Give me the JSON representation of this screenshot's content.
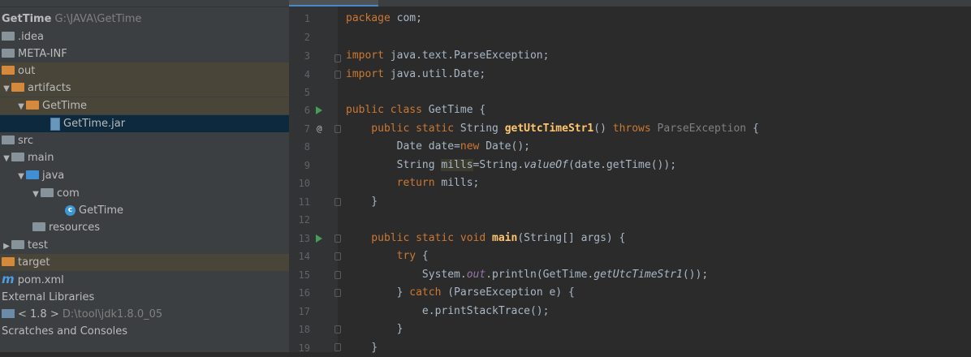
{
  "project_tree": {
    "root": {
      "name": "GetTime",
      "path": "G:\\JAVA\\GetTime"
    },
    "items": [
      {
        "label": ".idea"
      },
      {
        "label": "META-INF"
      },
      {
        "label": "out"
      },
      {
        "label": "artifacts"
      },
      {
        "label": "GetTime"
      },
      {
        "label": "GetTime.jar"
      },
      {
        "label": "src"
      },
      {
        "label": "main"
      },
      {
        "label": "java"
      },
      {
        "label": "com"
      },
      {
        "label": "GetTime"
      },
      {
        "label": "resources"
      },
      {
        "label": "test"
      },
      {
        "label": "target"
      },
      {
        "label": "pom.xml"
      },
      {
        "label": "External Libraries"
      },
      {
        "label": "< 1.8 >",
        "path": "D:\\tool\\jdk1.8.0_05"
      },
      {
        "label": "Scratches and Consoles"
      }
    ]
  },
  "editor": {
    "line_numbers": [
      "1",
      "2",
      "3",
      "4",
      "5",
      "6",
      "7",
      "8",
      "9",
      "10",
      "11",
      "12",
      "13",
      "14",
      "15",
      "16",
      "17",
      "18",
      "19"
    ],
    "code": {
      "l1_kw": "package",
      "l1_rest": " com;",
      "l3_kw": "import",
      "l3_rest": " java.text.ParseException;",
      "l4_kw": "import",
      "l4_rest": " java.util.Date;",
      "l6_kw": "public class",
      "l6_rest": " GetTime {",
      "l7_kw1": "    public static",
      "l7_t1": " String ",
      "l7_fn": "getUtcTimeStr1",
      "l7_t2": "() ",
      "l7_kw2": "throws",
      "l7_ex": " ParseException",
      "l7_t3": " {",
      "l8_t1": "        Date date=",
      "l8_kw": "new",
      "l8_t2": " Date();",
      "l9_t1": "        String ",
      "l9_hl": "mills",
      "l9_t2": "=String.",
      "l9_it": "valueOf",
      "l9_t3": "(date.getTime());",
      "l10_kw": "        return",
      "l10_t": " mills;",
      "l11": "    }",
      "l13_kw": "    public static void",
      "l13_fn": " main",
      "l13_t": "(String[] args) {",
      "l14_kw": "        try",
      "l14_t": " {",
      "l15_t1": "            System.",
      "l15_st": "out",
      "l15_t2": ".println(GetTime.",
      "l15_it": "getUtcTimeStr1",
      "l15_t3": "());",
      "l16_t1": "        } ",
      "l16_kw": "catch",
      "l16_t2": " (ParseException e) {",
      "l17": "            e.printStackTrace();",
      "l18": "        }",
      "l19": "    }",
      "gutter_at": "@"
    }
  }
}
